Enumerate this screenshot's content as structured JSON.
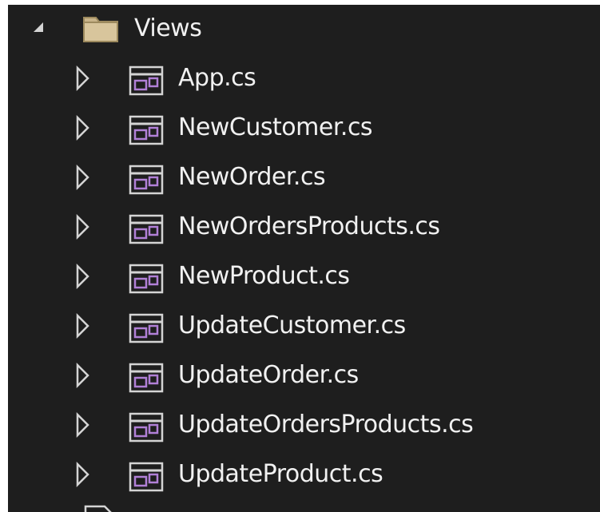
{
  "tree": {
    "folder": {
      "label": "Views",
      "expanded": true,
      "icon": "folder-icon"
    },
    "files": [
      {
        "label": "App.cs",
        "icon": "form-icon"
      },
      {
        "label": "NewCustomer.cs",
        "icon": "form-icon"
      },
      {
        "label": "NewOrder.cs",
        "icon": "form-icon"
      },
      {
        "label": "NewOrdersProducts.cs",
        "icon": "form-icon"
      },
      {
        "label": "NewProduct.cs",
        "icon": "form-icon"
      },
      {
        "label": "UpdateCustomer.cs",
        "icon": "form-icon"
      },
      {
        "label": "UpdateOrder.cs",
        "icon": "form-icon"
      },
      {
        "label": "UpdateOrdersProducts.cs",
        "icon": "form-icon"
      },
      {
        "label": "UpdateProduct.cs",
        "icon": "form-icon"
      }
    ]
  },
  "colors": {
    "background": "#1e1e1e",
    "text": "#f1f1f1",
    "folder": "#dcb67a",
    "form_accent": "#b180d7"
  }
}
